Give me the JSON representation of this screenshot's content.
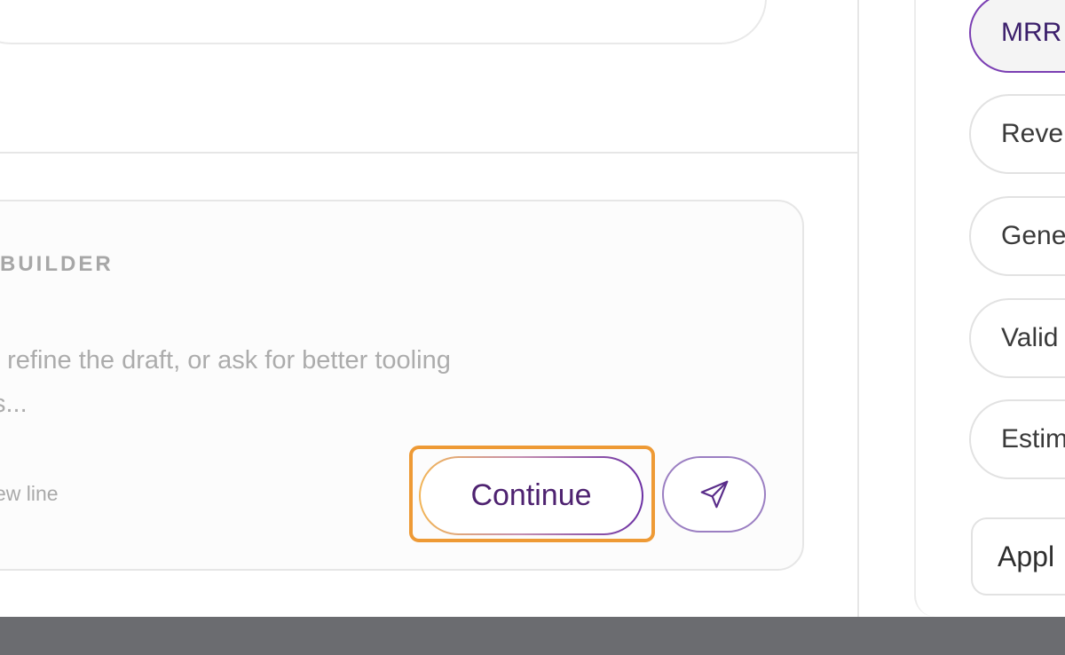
{
  "composer": {
    "title": "BUILDER",
    "placeholder_line1": ", refine the draft, or ask for better tooling",
    "placeholder_line2": "s...",
    "hint": "ew line",
    "continue_label": "Continue",
    "send_icon": "paper-plane-icon"
  },
  "sidebar": {
    "chips": [
      {
        "label": "MRR",
        "active": true
      },
      {
        "label": "Reve",
        "active": false
      },
      {
        "label": "Gene",
        "active": false
      },
      {
        "label": "Valid",
        "active": false
      },
      {
        "label": "Estim",
        "active": false
      }
    ],
    "apply_label": "Appl"
  },
  "colors": {
    "accent": "#6b2fa3",
    "focus_ring": "#ee9a35",
    "bottom_bar": "#6b6c70"
  }
}
